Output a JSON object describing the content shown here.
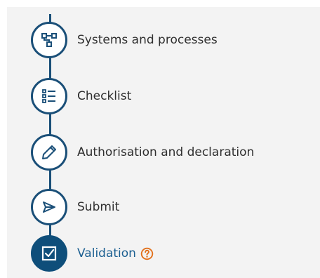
{
  "steps": [
    {
      "label": "Systems and processes",
      "icon": "process-flow-icon",
      "state": "complete"
    },
    {
      "label": "Checklist",
      "icon": "checklist-icon",
      "state": "complete"
    },
    {
      "label": "Authorisation and declaration",
      "icon": "pencil-icon",
      "state": "complete"
    },
    {
      "label": "Submit",
      "icon": "send-icon",
      "state": "complete"
    },
    {
      "label": "Validation",
      "icon": "checkbox-icon",
      "state": "current"
    }
  ],
  "help_icon": "question-circle-icon",
  "colors": {
    "accent": "#1a4f78",
    "active_fill": "#0e4e7a",
    "active_text": "#1b5f91",
    "help": "#e2701b",
    "background": "#f3f3f3"
  }
}
